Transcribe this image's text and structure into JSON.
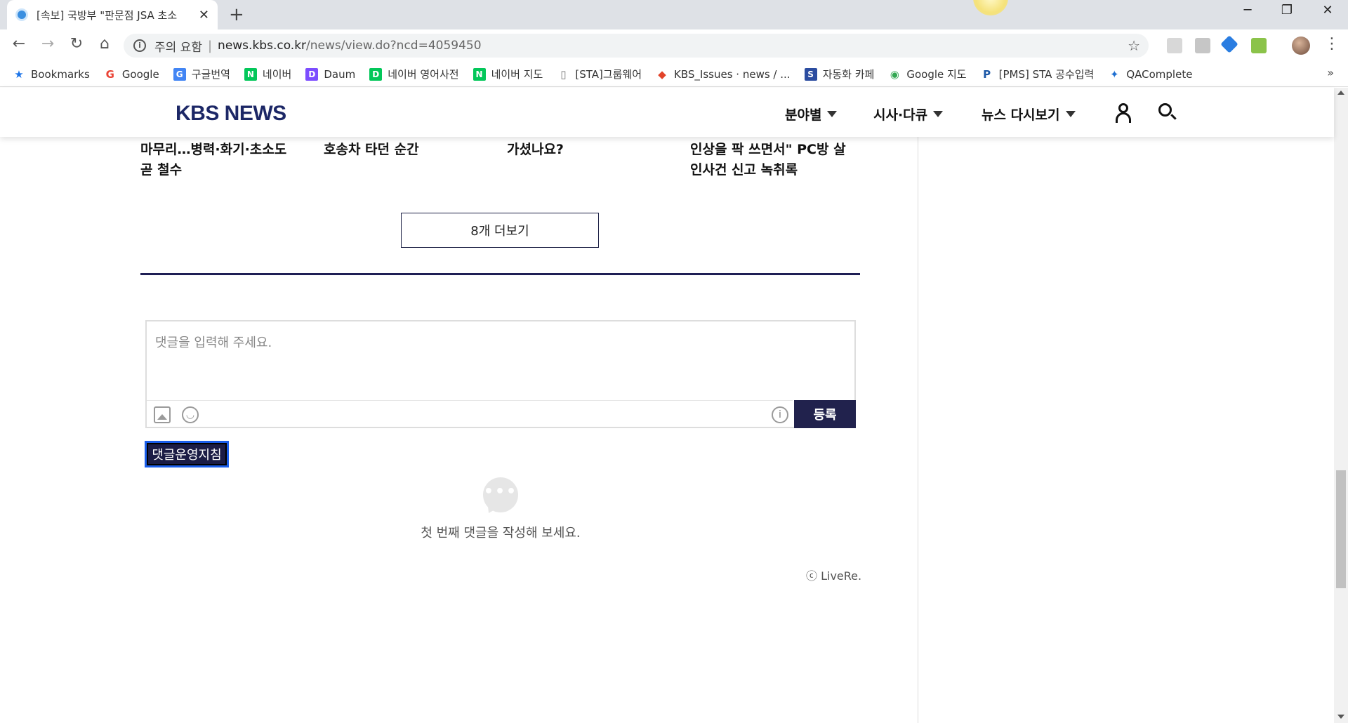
{
  "browser": {
    "tab_title": "[속보] 국방부 \"판문점 JSA 초소",
    "url_security": "주의 요함",
    "url_host": "news.kbs.co.kr",
    "url_path": "/news/view.do?ncd=4059450",
    "new_tab_label": "+",
    "win_min": "─",
    "win_max": "❐",
    "win_close": "✕"
  },
  "bookmarks": [
    {
      "label": "Bookmarks",
      "icon": "star-icon",
      "color": "#1a73e8"
    },
    {
      "label": "Google",
      "icon": "google-icon",
      "color": "#ea4335"
    },
    {
      "label": "구글번역",
      "icon": "translate-icon",
      "color": "#4285f4"
    },
    {
      "label": "네이버",
      "icon": "naver-icon",
      "color": "#03c75a"
    },
    {
      "label": "Daum",
      "icon": "daum-icon",
      "color": "#7c4dff"
    },
    {
      "label": "네이버 영어사전",
      "icon": "dict-icon",
      "color": "#03c75a"
    },
    {
      "label": "네이버 지도",
      "icon": "naver-icon",
      "color": "#03c75a"
    },
    {
      "label": "[STA]그룹웨어",
      "icon": "page-icon",
      "color": "#777777"
    },
    {
      "label": "KBS_Issues · news / ...",
      "icon": "gitlab-icon",
      "color": "#e24329"
    },
    {
      "label": "자동화 카페",
      "icon": "sta-icon",
      "color": "#2b4ca0"
    },
    {
      "label": "Google 지도",
      "icon": "maps-icon",
      "color": "#34a853"
    },
    {
      "label": "[PMS] STA 공수입력",
      "icon": "pms-icon",
      "color": "#1b57a6"
    },
    {
      "label": "QAComplete",
      "icon": "qacomplete-icon",
      "color": "#1f6fd1"
    }
  ],
  "site": {
    "logo": "KBS NEWS",
    "brand_color": "#1c2766",
    "menu": [
      "분야별",
      "시사·다큐",
      "뉴스 다시보기"
    ]
  },
  "articles": [
    {
      "title": "마무리…병력·화기·초소도 곧 철수"
    },
    {
      "title": "호송차 타던 순간"
    },
    {
      "title": "가셨나요?"
    },
    {
      "title": "인상을 팍 쓰면서\" PC방 살인사건 신고 녹취록"
    }
  ],
  "more_button": "8개 더보기",
  "comments": {
    "placeholder": "댓글을 입력해 주세요.",
    "submit": "등록",
    "guide": "댓글운영지침",
    "empty": "첫 번째 댓글을 작성해 보세요.",
    "provider": "ⓒ LiveRe."
  }
}
